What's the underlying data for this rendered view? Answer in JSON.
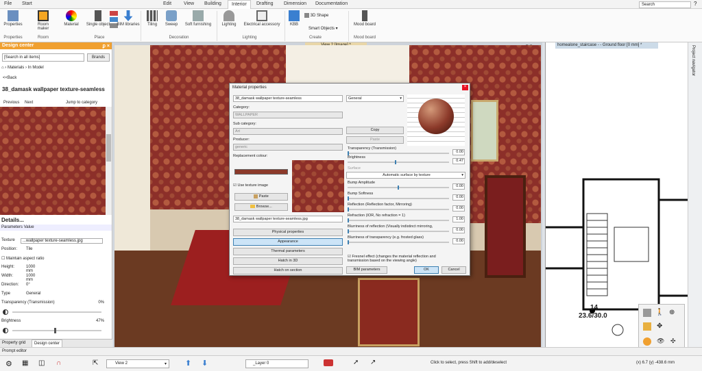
{
  "menu": [
    "File",
    "Start",
    "Edit",
    "View",
    "Building",
    "Interior",
    "Drafting",
    "Dimension",
    "Documentation"
  ],
  "search_placeholder": "Search",
  "ribbon": {
    "buttons": [
      "Properties",
      "Room maker",
      "Material",
      "Single object",
      "BIM libraries",
      "Tiling",
      "Sweep",
      "Soft furnishing",
      "Lighting",
      "Electrical accessory",
      "KBB",
      "3D Shape",
      "Smart Objects",
      "Mood board"
    ],
    "groups": [
      "Properties",
      "Room",
      "Place",
      "Decoration",
      "Lighting",
      "Create",
      "Mood board"
    ]
  },
  "design_center": {
    "title": "Design center",
    "search": "[Search in all items]",
    "brands": "Brands",
    "breadcrumb": [
      "Materials",
      "In Model"
    ],
    "back": "<<Back",
    "material_name": "38_damask wallpaper texture-seamless",
    "nav": [
      "Previous",
      "Next",
      "Jump to category"
    ],
    "details": "Details...",
    "cols": [
      "Parameters",
      "Value"
    ],
    "props": [
      {
        "k": "Texture",
        "v": "...wallpaper texture-seamless.jpg"
      },
      {
        "k": "Position:",
        "v": "Tile"
      },
      {
        "k": "Maintain aspect ratio",
        "v": ""
      },
      {
        "k": "Height:",
        "v": "1000 mm"
      },
      {
        "k": "Width:",
        "v": "1000 mm"
      },
      {
        "k": "Direction:",
        "v": "0°"
      },
      {
        "k": "Type",
        "v": "General"
      },
      {
        "k": "Transparency (Transmission)",
        "v": "0%"
      },
      {
        "k": "Brightness",
        "v": "47%"
      }
    ],
    "tabs": [
      "Property grid",
      "Design center"
    ]
  },
  "view_tab": "View 2 [Image] *",
  "plan_tab": "homealone_staircase -  - Ground floor [0 mm] *",
  "plan_labels": {
    "n": "14",
    "dim": "23.6/30.0"
  },
  "project_navigator": "Project navigator",
  "dialog": {
    "title": "Material properties",
    "name": "38_damask wallpaper texture-seamless",
    "category_label": "Category:",
    "category": "WALLPAPER",
    "subcat_label": "Sub category:",
    "subcat": "Art",
    "producer_label": "Producer:",
    "producer": "generic",
    "replacement_label": "Replacement colour:",
    "use_texture": "Use texture image",
    "paste": "Paste",
    "browse": "Browse...",
    "file": "38_damask wallpaper texture-seamless.jpg",
    "sections": [
      "Physical properties",
      "Appearance",
      "Thermal parameters",
      "Hatch in 3D",
      "Hatch on section"
    ],
    "mode": "General",
    "copy": "Copy",
    "paste2": "Paste",
    "surface_label": "Surface",
    "surface": "Automatic surface by texture",
    "params": [
      {
        "label": "Transparency (Transmission)",
        "value": "0.00",
        "pos": 0
      },
      {
        "label": "Brightness",
        "value": "0.47",
        "pos": 0.47
      },
      {
        "label": "Bump Amplitude",
        "value": "0.00",
        "pos": 0.5
      },
      {
        "label": "Bump Softness",
        "value": "0.00",
        "pos": 0
      },
      {
        "label": "Reflection (Reflection factor, Mirroring)",
        "value": "0.00",
        "pos": 0
      },
      {
        "label": "Refraction (IOR, No refraction = 1)",
        "value": "1.00",
        "pos": 0
      },
      {
        "label": "Blurriness of reflection (Visually indistinct mirroring,",
        "value": "0.00",
        "pos": 0
      },
      {
        "label": "Blurriness of transparency (e.g. frosted glass)",
        "value": "0.00",
        "pos": 0
      }
    ],
    "fresnel": "Fresnel effect (changes the material reflection and transmission based on the viewing angle)",
    "bim": "BIM parameters",
    "ok": "OK",
    "cancel": "Cancel"
  },
  "prompt": "Prompt editor",
  "status": {
    "view": "View 2",
    "layer": "_Layer 0",
    "hint": "Click to select, press Shift to add/deselect",
    "coords": "(x) 6.7  (y) -438.6 mm"
  },
  "colors": {
    "accent": "#f0a030",
    "wallpaper": "#8c2f29",
    "selected": "#cce4f7"
  }
}
